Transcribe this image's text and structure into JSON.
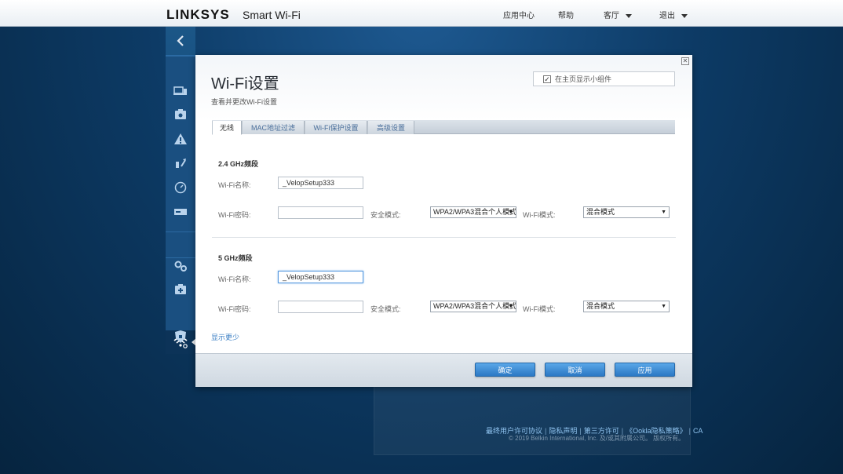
{
  "header": {
    "logo": "LINKSYS",
    "logo_sub": "Smart Wi-Fi",
    "links": {
      "app_center": "应用中心",
      "help": "帮助",
      "guest": "客厅",
      "logout": "退出"
    }
  },
  "modal": {
    "title": "Wi-Fi设置",
    "subtitle": "查看并更改Wi-Fi设置",
    "widget_checkbox_label": "在主页显示小组件",
    "widget_checked": true,
    "tabs": [
      "无线",
      "MAC地址过滤",
      "Wi-Fi保护设置",
      "高级设置"
    ],
    "active_tab": "无线",
    "band24": {
      "heading": "2.4 GHz频段",
      "name_label": "Wi-Fi名称:",
      "name_value": "_VelopSetup333",
      "password_label": "Wi-Fi密码:",
      "password_value": "",
      "security_label": "安全模式:",
      "security_value": "WPA2/WPA3混合个人模式",
      "mode_label": "Wi-Fi模式:",
      "mode_value": "混合模式"
    },
    "band5": {
      "heading": "5 GHz频段",
      "name_label": "Wi-Fi名称:",
      "name_value": "_VelopSetup333",
      "password_label": "Wi-Fi密码:",
      "password_value": "",
      "security_label": "安全模式:",
      "security_value": "WPA2/WPA3混合个人模式",
      "mode_label": "Wi-Fi模式:",
      "mode_value": "混合模式"
    },
    "show_less": "显示更少",
    "buttons": {
      "ok": "确定",
      "cancel": "取消",
      "apply": "应用"
    }
  },
  "footer": {
    "links": [
      "最终用户许可协议",
      "隐私声明",
      "第三方许可",
      "《Ookla隐私策略》",
      "CA"
    ],
    "copyright": "© 2019 Belkin International, Inc. 及/或其附属公司。 版权所有。"
  },
  "colors": {
    "accent": "#2b78c4",
    "background": "#0d3b66",
    "link": "#3b7fc4"
  }
}
